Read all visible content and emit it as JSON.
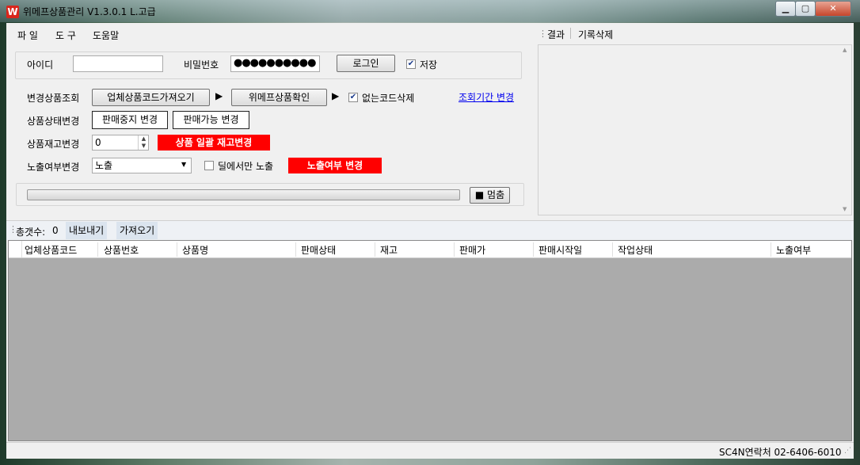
{
  "window": {
    "title": "위메프상품관리 V1.3.0.1 L.고급",
    "icon_letter": "W"
  },
  "menu": [
    "파 일",
    "도 구",
    "도움말"
  ],
  "login": {
    "id_label": "아이디",
    "id_value": "",
    "pw_label": "비밀번호",
    "pw_value": "●●●●●●●●●●",
    "login_button": "로그인",
    "save_label": "저장",
    "save_checked": true
  },
  "change": {
    "lookup_label": "변경상품조회",
    "fetch_button": "업체상품코드가져오기",
    "confirm_button": "위메프상품확인",
    "delete_missing_label": "없는코드삭제",
    "delete_missing_checked": true,
    "period_link": "조회기간 변경",
    "status_label": "상품상태변경",
    "stop_button": "판매중지 변경",
    "available_button": "판매가능 변경",
    "stock_label": "상품재고변경",
    "stock_value": "0",
    "bulk_stock_button": "상품 일괄 재고변경",
    "expose_label": "노출여부변경",
    "expose_value": "노출",
    "deal_only_label": "딜에서만 노출",
    "deal_only_checked": false,
    "expose_button": "노출여부 변경",
    "progress": 0,
    "stop_progress_button": "멈춤"
  },
  "result": {
    "tab_result": "결과",
    "tab_clear": "기록삭제"
  },
  "list_toolbar": {
    "total_label": "총갯수:",
    "total_value": "0",
    "export_button": "내보내기",
    "import_button": "가져오기"
  },
  "table": {
    "columns": [
      "업체상품코드",
      "상품번호",
      "상품명",
      "판매상태",
      "재고",
      "판매가",
      "판매시작일",
      "작업상태",
      "노출여부"
    ],
    "rows": []
  },
  "status_bar": {
    "contact": "SC4N연락처 02-6406-6010"
  }
}
